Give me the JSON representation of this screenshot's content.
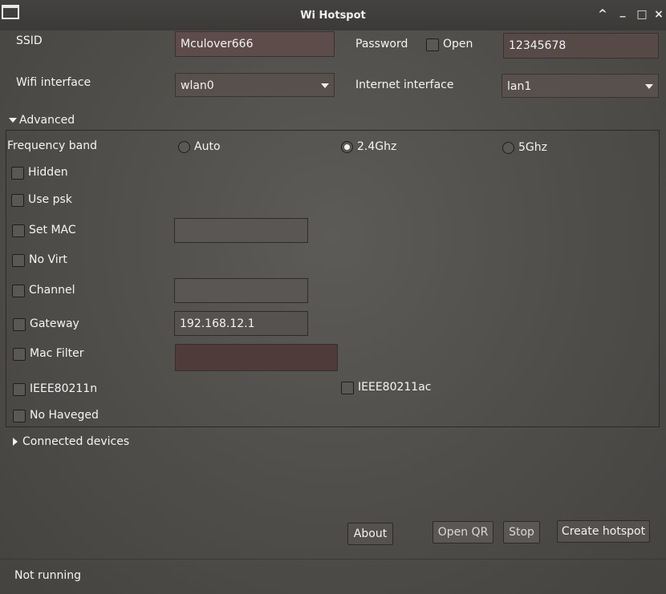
{
  "window": {
    "title": "Wi Hotspot",
    "controls": [
      "^",
      "_",
      "□",
      "×"
    ]
  },
  "ssid": {
    "label": "SSID",
    "value": "Mculover666"
  },
  "password": {
    "label": "Password",
    "open_label": "Open",
    "open_checked": false,
    "value": "12345678"
  },
  "wifi_interface": {
    "label": "Wifi interface",
    "value": "wlan0"
  },
  "internet_interface": {
    "label": "Internet interface",
    "value": "lan1"
  },
  "advanced": {
    "label": "Advanced",
    "expanded": true,
    "frequency": {
      "label": "Frequency band",
      "options": [
        {
          "label": "Auto",
          "selected": false
        },
        {
          "label": "2.4Ghz",
          "selected": true
        },
        {
          "label": "5Ghz",
          "selected": false
        }
      ]
    },
    "hidden": {
      "label": "Hidden",
      "checked": false
    },
    "use_psk": {
      "label": "Use psk",
      "checked": false
    },
    "set_mac": {
      "label": "Set MAC",
      "checked": false,
      "value": ""
    },
    "no_virt": {
      "label": "No Virt",
      "checked": false
    },
    "channel": {
      "label": "Channel",
      "checked": false,
      "value": ""
    },
    "gateway": {
      "label": "Gateway",
      "checked": false,
      "value": "192.168.12.1"
    },
    "mac_filter": {
      "label": "Mac Filter",
      "checked": false,
      "value": ""
    },
    "ieee80211n": {
      "label": "IEEE80211n",
      "checked": false
    },
    "ieee80211ac": {
      "label": "IEEE80211ac",
      "checked": false
    },
    "no_haveged": {
      "label": "No Haveged",
      "checked": false
    }
  },
  "connected_devices": {
    "label": "Connected devices",
    "expanded": false
  },
  "buttons": {
    "about": "About",
    "open_qr": "Open QR",
    "stop": "Stop",
    "create": "Create hotspot"
  },
  "status": {
    "text": "Not running"
  }
}
